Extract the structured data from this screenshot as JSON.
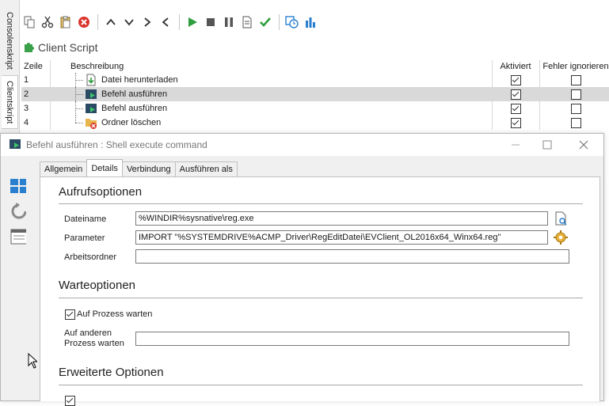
{
  "side_tabs": [
    "Consolenskript",
    "Clientskript"
  ],
  "toolbar": {
    "icons": [
      "copy-icon",
      "cut-icon",
      "paste-icon",
      "delete-icon",
      "move-up-icon",
      "move-down-icon",
      "indent-icon",
      "outdent-icon",
      "run-icon",
      "stop-icon",
      "pause-icon",
      "report-icon",
      "check-icon",
      "schedule-icon",
      "statistics-icon"
    ]
  },
  "client_script": {
    "title": "Client Script"
  },
  "grid": {
    "headers": {
      "zeile": "Zeile",
      "beschreibung": "Beschreibung",
      "aktiviert": "Aktiviert",
      "fehler": "Fehler ignorieren"
    },
    "rows": [
      {
        "zeile": "1",
        "beschreibung": "Datei herunterladen",
        "aktiviert": true,
        "fehler": false,
        "icon": "download-file-icon",
        "selected": false
      },
      {
        "zeile": "2",
        "beschreibung": "Befehl ausführen",
        "aktiviert": true,
        "fehler": false,
        "icon": "shell-execute-icon",
        "selected": true
      },
      {
        "zeile": "3",
        "beschreibung": "Befehl ausführen",
        "aktiviert": true,
        "fehler": false,
        "icon": "shell-execute-icon",
        "selected": false
      },
      {
        "zeile": "4",
        "beschreibung": "Ordner löschen",
        "aktiviert": true,
        "fehler": false,
        "icon": "delete-folder-icon",
        "selected": false
      }
    ]
  },
  "dialog": {
    "title": "Befehl ausführen : Shell execute command",
    "tabs": [
      "Allgemein",
      "Details",
      "Verbindung",
      "Ausführen als"
    ],
    "active_tab": "Details",
    "sections": {
      "aufruf": "Aufrufsoptionen",
      "warte": "Warteoptionen",
      "erweitert": "Erweiterte Optionen"
    },
    "fields": {
      "dateiname_label": "Dateiname",
      "dateiname_value": "%WINDIR%sysnative\\reg.exe",
      "parameter_label": "Parameter",
      "parameter_value": "IMPORT \"%SYSTEMDRIVE%ACMP_Driver\\RegEditDatei\\EVClient_OL2016x64_Winx64.reg\"",
      "arbeitsordner_label": "Arbeitsordner",
      "arbeitsordner_value": "",
      "auf_prozess_label": "Auf Prozess warten",
      "auf_prozess_checked": true,
      "andere_label_1": "Auf anderen",
      "andere_label_2": "Prozess warten",
      "andere_value": ""
    }
  },
  "colors": {
    "accent_green": "#2e9e3e",
    "accent_blue": "#2a7fcf",
    "delete_red": "#d9342b"
  }
}
